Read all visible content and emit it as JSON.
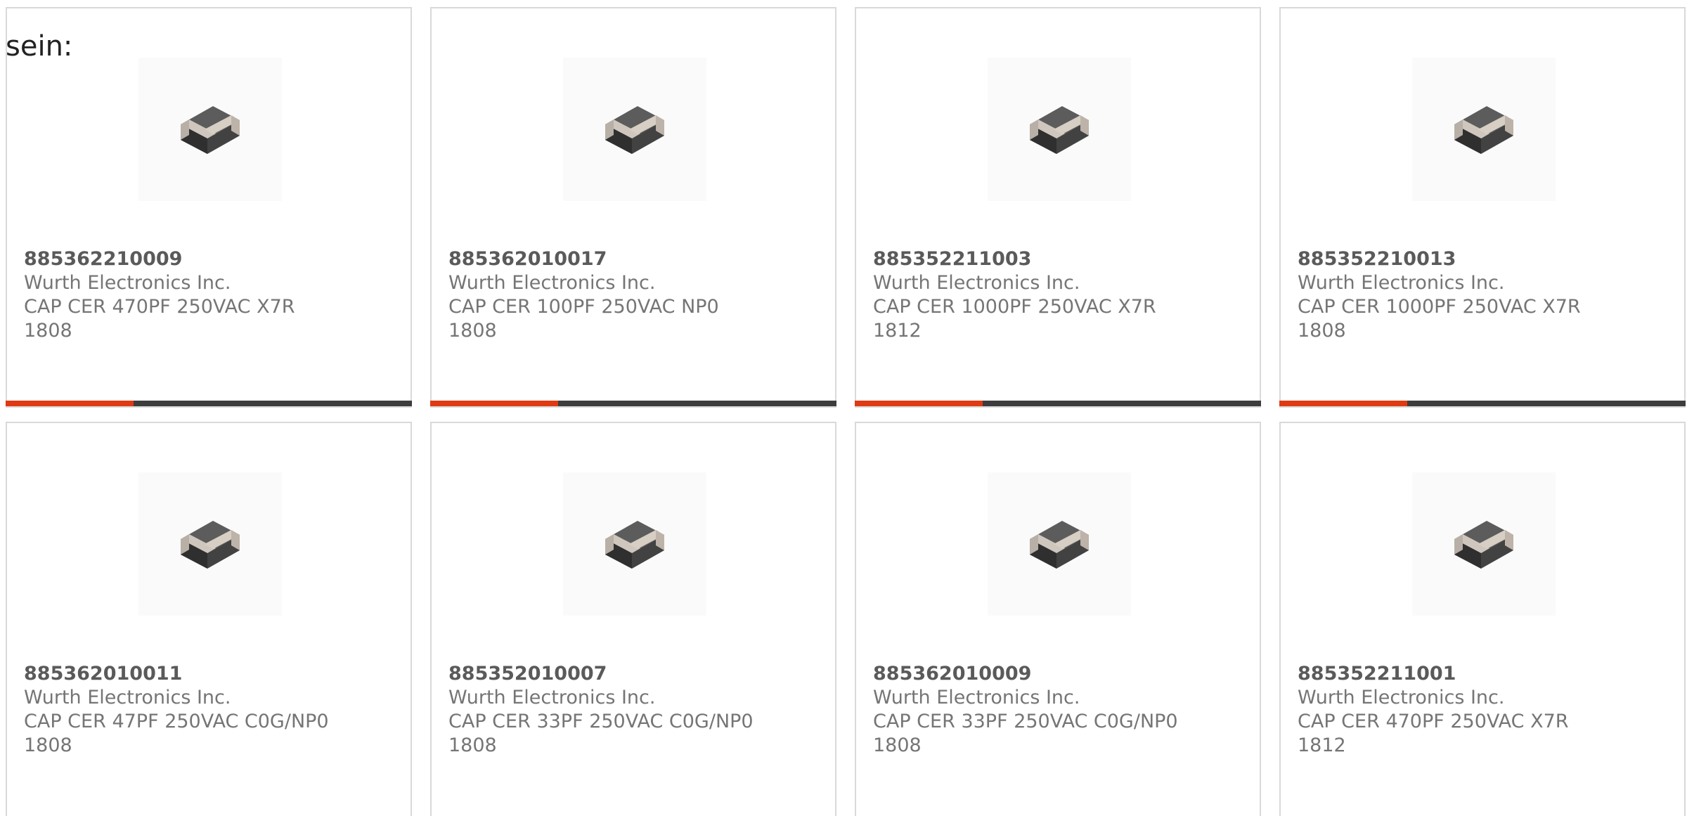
{
  "intro_text": "sein:",
  "colors": {
    "card_border": "#d9d9d9",
    "accent_bar": "#e03a12",
    "dark_bar": "#3d3d3d",
    "text": "#757575",
    "part_number": "#5a5a5a"
  },
  "products": [
    {
      "part_number": "885362210009",
      "manufacturer": "Wurth Electronics Inc.",
      "description": "CAP CER 470PF 250VAC X7R",
      "package": "1808",
      "image_icon": "ceramic-capacitor-chip-icon",
      "progress_fraction": 0.315
    },
    {
      "part_number": "885362010017",
      "manufacturer": "Wurth Electronics Inc.",
      "description": "CAP CER 100PF 250VAC NP0",
      "package": "1808",
      "image_icon": "ceramic-capacitor-chip-icon",
      "progress_fraction": 0.315
    },
    {
      "part_number": "885352211003",
      "manufacturer": "Wurth Electronics Inc.",
      "description": "CAP CER 1000PF 250VAC X7R",
      "package": "1812",
      "image_icon": "ceramic-capacitor-chip-icon",
      "progress_fraction": 0.315
    },
    {
      "part_number": "885352210013",
      "manufacturer": "Wurth Electronics Inc.",
      "description": "CAP CER 1000PF 250VAC X7R",
      "package": "1808",
      "image_icon": "ceramic-capacitor-chip-icon",
      "progress_fraction": 0.315
    },
    {
      "part_number": "885362010011",
      "manufacturer": "Wurth Electronics Inc.",
      "description": "CAP CER 47PF 250VAC C0G/NP0",
      "package": "1808",
      "image_icon": "ceramic-capacitor-chip-icon"
    },
    {
      "part_number": "885352010007",
      "manufacturer": "Wurth Electronics Inc.",
      "description": "CAP CER 33PF 250VAC C0G/NP0",
      "package": "1808",
      "image_icon": "ceramic-capacitor-chip-icon"
    },
    {
      "part_number": "885362010009",
      "manufacturer": "Wurth Electronics Inc.",
      "description": "CAP CER 33PF 250VAC C0G/NP0",
      "package": "1808",
      "image_icon": "ceramic-capacitor-chip-icon"
    },
    {
      "part_number": "885352211001",
      "manufacturer": "Wurth Electronics Inc.",
      "description": "CAP CER 470PF 250VAC X7R",
      "package": "1812",
      "image_icon": "ceramic-capacitor-chip-icon"
    }
  ]
}
